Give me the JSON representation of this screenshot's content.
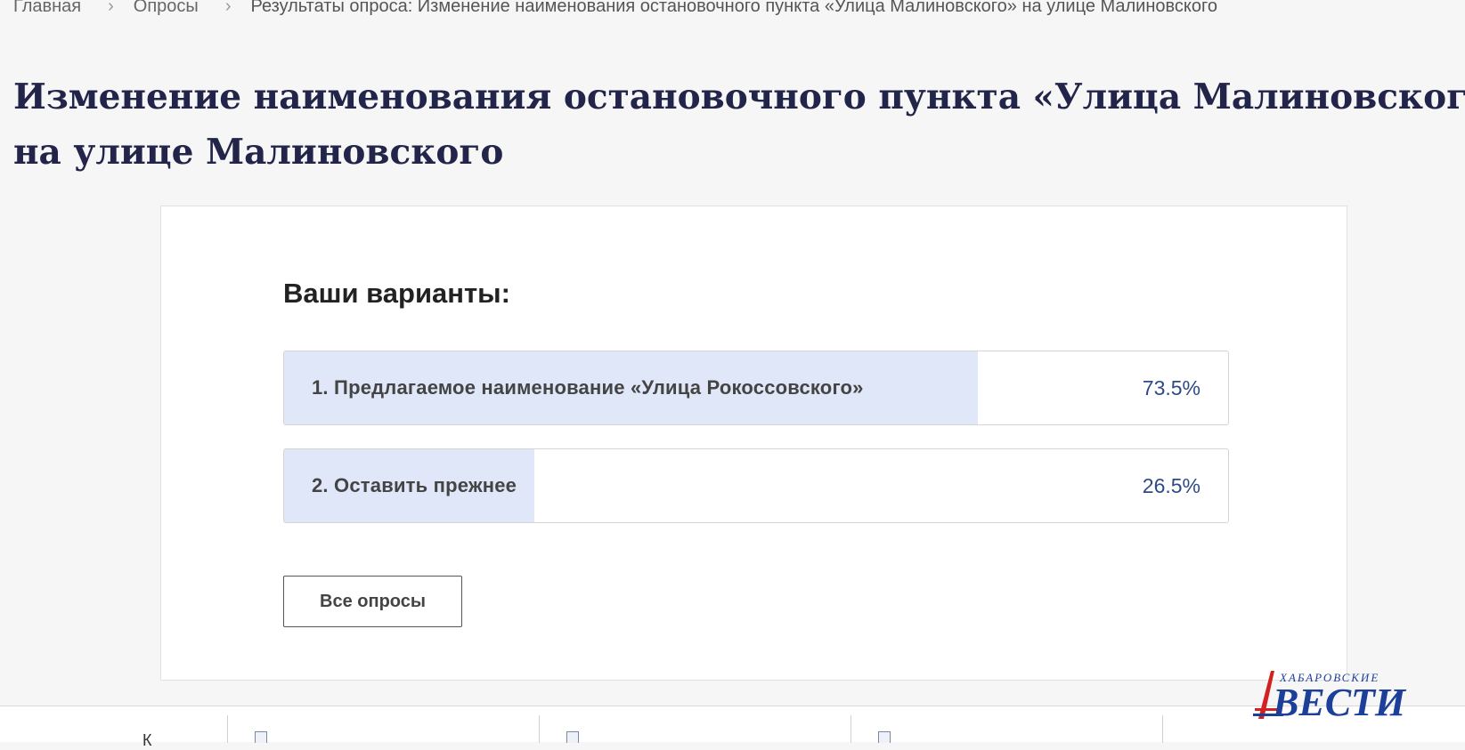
{
  "breadcrumb": {
    "home": "Главная",
    "polls": "Опросы",
    "current": "Результаты опроса: Изменение наименования остановочного пункта «Улица Малиновского» на улице Малиновского",
    "separator": "›"
  },
  "page": {
    "title_line1": "Изменение наименования остановочного пункта «Улица Малиновского»",
    "title_line2": "на улице Малиновского"
  },
  "results": {
    "heading": "Ваши варианты:",
    "options": [
      {
        "label": "1. Предлагаемое наименование «Улица Рокоссовского»",
        "percent_text": "73.5%",
        "percent": 73.5
      },
      {
        "label": "2. Оставить прежнее",
        "percent_text": "26.5%",
        "percent": 26.5
      }
    ],
    "all_polls_button": "Все опросы"
  },
  "logo": {
    "text_top": "ХАБАРОВСКИЕ",
    "text_main": "ВЕСТИ"
  },
  "colors": {
    "title": "#22244a",
    "bar_fill": "#dfe7f8",
    "percent": "#2e4a86",
    "logo": "#1c3f9a",
    "logo_accent": "#d32020"
  }
}
